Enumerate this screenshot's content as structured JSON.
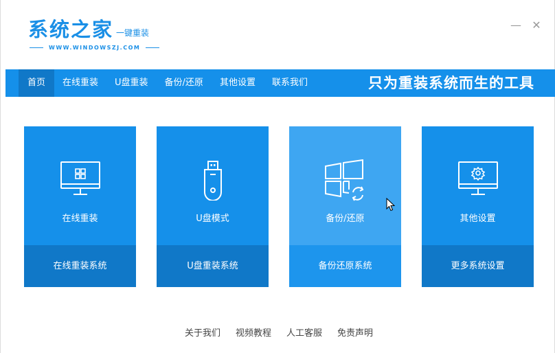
{
  "brand": {
    "title": "系统之家",
    "tagline": "一键重装",
    "url": "WWW.WINDOWSZJ.COM"
  },
  "window_controls": {
    "minimize": "—",
    "close": "✕"
  },
  "nav": {
    "items": [
      {
        "label": "首页",
        "active": true
      },
      {
        "label": "在线重装"
      },
      {
        "label": "U盘重装"
      },
      {
        "label": "备份/还原"
      },
      {
        "label": "其他设置"
      },
      {
        "label": "联系我们"
      }
    ],
    "slogan": "只为重装系统而生的工具"
  },
  "cards": [
    {
      "label": "在线重装",
      "action": "在线重装系统",
      "icon": "monitor-windows-icon"
    },
    {
      "label": "U盘模式",
      "action": "U盘重装系统",
      "icon": "usb-drive-icon"
    },
    {
      "label": "备份/还原",
      "action": "备份还原系统",
      "icon": "windows-restore-icon",
      "hover": true
    },
    {
      "label": "其他设置",
      "action": "更多系统设置",
      "icon": "monitor-gear-icon"
    }
  ],
  "footer": {
    "links": [
      "关于我们",
      "视频教程",
      "人工客服",
      "免责声明"
    ]
  },
  "colors": {
    "primary": "#1590ea",
    "primary_dark": "#1078c8",
    "hover": "#3ea6f2"
  }
}
